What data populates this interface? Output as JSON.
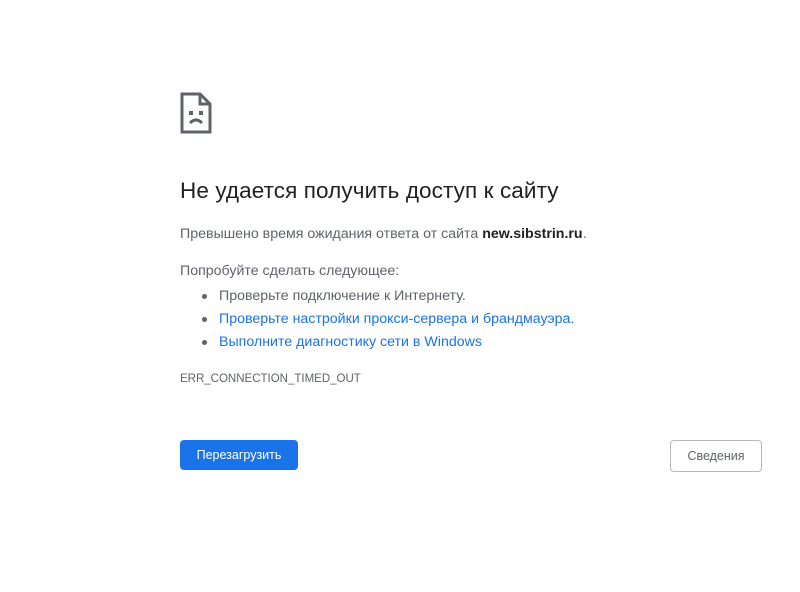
{
  "error_page": {
    "icon": "sad-document-icon",
    "title": "Не удается получить доступ к сайту",
    "summary_prefix": "Превышено время ожидания ответа от сайта ",
    "host": "new.sibstrin.ru",
    "summary_suffix": ".",
    "try_label": "Попробуйте сделать следующее:",
    "suggestions": [
      {
        "label": "Проверьте подключение к Интернету.",
        "is_link": false
      },
      {
        "label": "Проверьте настройки прокси-сервера и брандмауэра.",
        "is_link": true
      },
      {
        "label": "Выполните диагностику сети в Windows",
        "is_link": true
      }
    ],
    "error_code": "ERR_CONNECTION_TIMED_OUT",
    "reload_label": "Перезагрузить",
    "details_label": "Сведения"
  },
  "colors": {
    "accent": "#1a73e8",
    "text_primary": "#202124",
    "text_secondary": "#5f6368"
  }
}
